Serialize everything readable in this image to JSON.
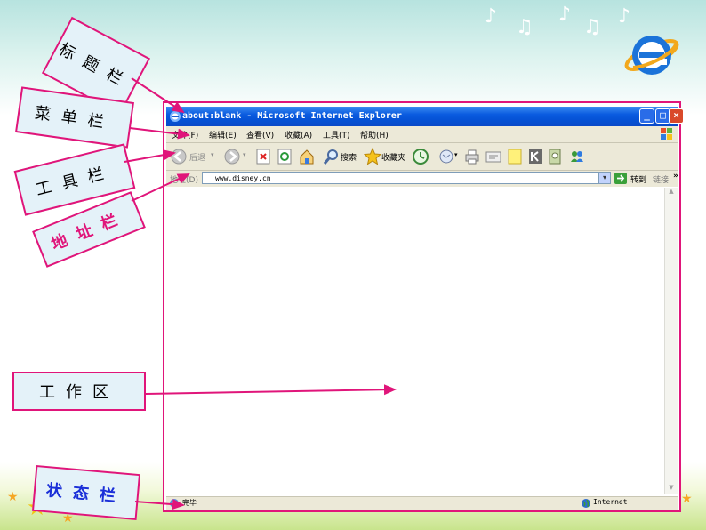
{
  "browser": {
    "title": "about:blank - Microsoft Internet Explorer",
    "window_buttons": [
      "_",
      "□",
      "×"
    ],
    "menu": [
      "文件(F)",
      "编辑(E)",
      "查看(V)",
      "收藏(A)",
      "工具(T)",
      "帮助(H)"
    ],
    "toolbar": {
      "back_label": "后退",
      "search_label": "搜索",
      "favorites_label": "收藏夹"
    },
    "address": {
      "label": "地址(D)",
      "value": "www.disney.cn",
      "go_label": "转到",
      "links_label": "链接",
      "more": "»"
    },
    "status": {
      "text": "完毕",
      "zone": "Internet"
    }
  },
  "callouts": {
    "title_bar": "标题栏",
    "menu_bar": "菜单栏",
    "tool_bar": "工具栏",
    "address_bar": "地址栏",
    "work_area": "工作区",
    "status_bar": "状态栏"
  },
  "colors": {
    "accent": "#e0157a",
    "titlebar": "#0a5be0",
    "callout_bg": "#e4f2f9"
  },
  "icons": [
    "back-icon",
    "forward-icon",
    "stop-icon",
    "refresh-icon",
    "home-icon",
    "search-icon",
    "favorites-icon",
    "history-icon",
    "mail-icon",
    "print-icon",
    "edit-icon",
    "discuss-icon",
    "messenger-icon",
    "research-icon",
    "ie-logo-icon",
    "music-note-icon",
    "star-icon"
  ]
}
